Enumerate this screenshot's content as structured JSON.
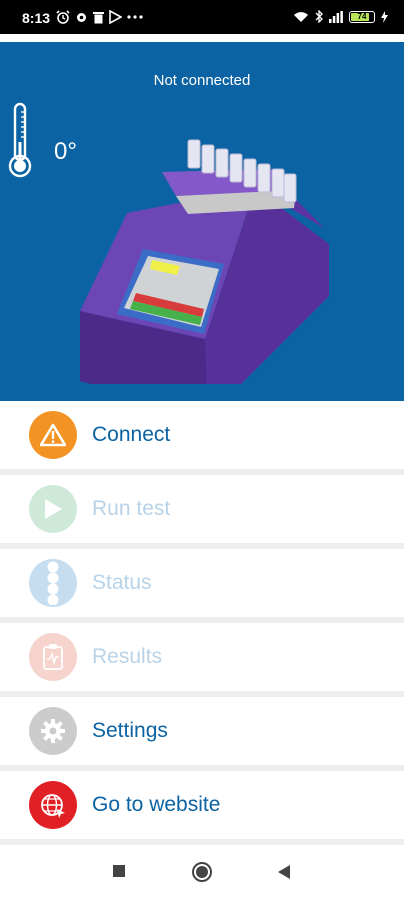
{
  "status_bar": {
    "time": "8:13",
    "battery_level": "74",
    "colors": {
      "background": "#000000",
      "battery_fill": "#b8e45a"
    }
  },
  "hero": {
    "connection_status": "Not connected",
    "temperature": "0°",
    "background_color": "#0c63a3"
  },
  "menu": {
    "items": [
      {
        "label": "Connect",
        "icon": "warning-icon",
        "color": "#f39323",
        "enabled": true
      },
      {
        "label": "Run test",
        "icon": "play-icon",
        "color": "#cfe9d8",
        "enabled": false
      },
      {
        "label": "Status",
        "icon": "status-dots-icon",
        "color": "#c6ddef",
        "enabled": false
      },
      {
        "label": "Results",
        "icon": "clipboard-icon",
        "color": "#f6d3cd",
        "enabled": false
      },
      {
        "label": "Settings",
        "icon": "gear-icon",
        "color": "#cccccc",
        "enabled": true
      },
      {
        "label": "Go to website",
        "icon": "globe-icon",
        "color": "#e12026",
        "enabled": true
      }
    ],
    "label_color": "#0c63a3",
    "disabled_label_color": "#b8d3e8"
  },
  "nav_bar": {
    "buttons": [
      "recents-square-icon",
      "home-circle-icon",
      "back-triangle-icon"
    ]
  }
}
